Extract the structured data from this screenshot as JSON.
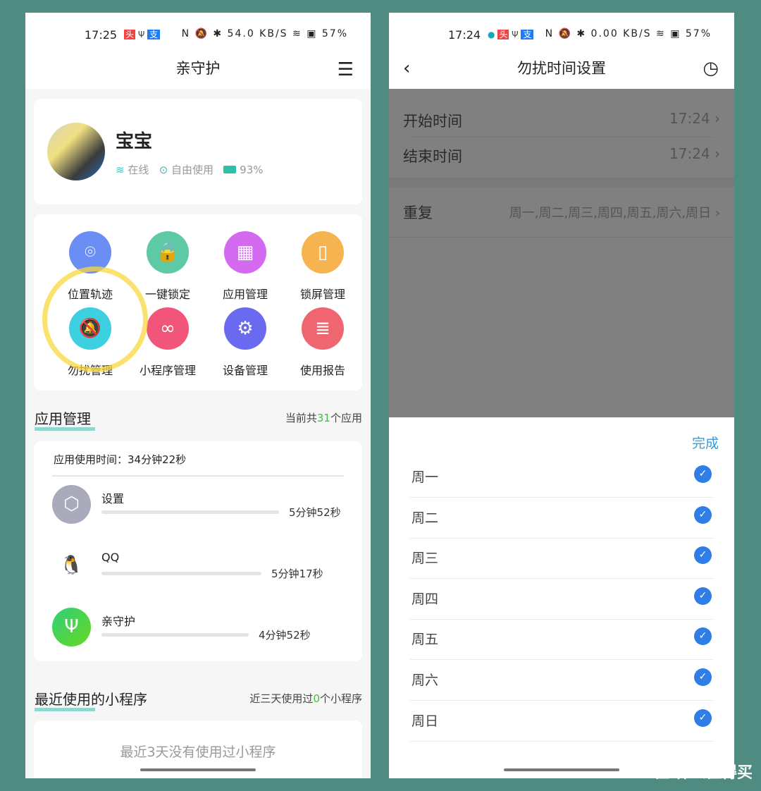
{
  "left": {
    "status": {
      "time": "17:25",
      "icons": "N 🔕 ✱ 54.0 KB/S ≋ ▣",
      "battery": "57%"
    },
    "title": "亲守护",
    "profile": {
      "name": "宝宝",
      "online": "在线",
      "mode": "自由使用",
      "battery": "93%"
    },
    "features": [
      {
        "label": "位置轨迹",
        "icon": "location-icon",
        "color": "#6b8ef5",
        "glyph": "⌾"
      },
      {
        "label": "一键锁定",
        "icon": "lock-icon",
        "color": "#5ec9a5",
        "glyph": "🔒"
      },
      {
        "label": "应用管理",
        "icon": "apps-grid-icon",
        "color": "#d46af0",
        "glyph": "▦"
      },
      {
        "label": "锁屏管理",
        "icon": "lock-screen-icon",
        "color": "#f5b44f",
        "glyph": "▯"
      },
      {
        "label": "勿扰管理",
        "icon": "bell-off-icon",
        "color": "#3dd0e0",
        "glyph": "🔕"
      },
      {
        "label": "小程序管理",
        "icon": "mini-program-icon",
        "color": "#f2557a",
        "glyph": "∞"
      },
      {
        "label": "设备管理",
        "icon": "gear-icon",
        "color": "#6a6af0",
        "glyph": "⚙"
      },
      {
        "label": "使用报告",
        "icon": "report-icon",
        "color": "#ef6670",
        "glyph": "≣"
      }
    ],
    "app_section": {
      "title": "应用管理",
      "count_prefix": "当前共",
      "count": "31",
      "count_suffix": "个应用",
      "total": "应用使用时间：34分钟22秒",
      "apps": [
        {
          "name": "设置",
          "duration": "5分钟52秒",
          "fraction": 1.0
        },
        {
          "name": "QQ",
          "duration": "5分钟17秒",
          "fraction": 0.9
        },
        {
          "name": "亲守护",
          "duration": "4分钟52秒",
          "fraction": 0.83
        }
      ]
    },
    "mini_section": {
      "title": "最近使用的小程序",
      "count_prefix": "近三天使用过",
      "count": "0",
      "count_suffix": "个小程序",
      "empty": "最近3天没有使用过小程序"
    }
  },
  "right": {
    "status": {
      "time": "17:24",
      "icons": "N 🔕 ✱ 0.00 KB/S ≋ ▣",
      "battery": "57%"
    },
    "title": "勿扰时间设置",
    "start": {
      "label": "开始时间",
      "value": "17:24"
    },
    "end": {
      "label": "结束时间",
      "value": "17:24"
    },
    "repeat": {
      "label": "重复",
      "value": "周一,周二,周三,周四,周五,周六,周日"
    },
    "done": "完成",
    "days": [
      "周一",
      "周二",
      "周三",
      "周四",
      "周五",
      "周六",
      "周日"
    ],
    "accent": "#2f7de6"
  },
  "watermark": "值 什么值得买"
}
